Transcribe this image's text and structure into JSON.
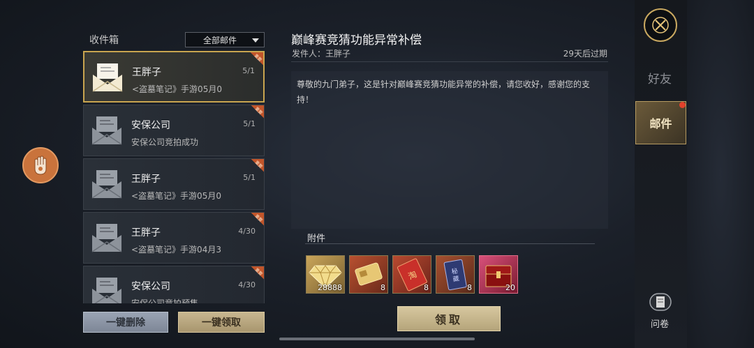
{
  "inbox": {
    "title": "收件箱",
    "filter_value": "全部邮件",
    "mails": [
      {
        "sender": "王胖子",
        "preview": "<盗墓笔记》手游05月0",
        "date": "5/1",
        "tag": "重要",
        "selected": true,
        "opened": true
      },
      {
        "sender": "安保公司",
        "preview": "安保公司竞拍成功",
        "date": "5/1",
        "tag": "重要",
        "selected": false,
        "opened": false
      },
      {
        "sender": "王胖子",
        "preview": "<盗墓笔记》手游05月0",
        "date": "5/1",
        "tag": "重要",
        "selected": false,
        "opened": true
      },
      {
        "sender": "王胖子",
        "preview": "<盗墓笔记》手游04月3",
        "date": "4/30",
        "tag": "重要",
        "selected": false,
        "opened": true
      },
      {
        "sender": "安保公司",
        "preview": "安保公司竞拍预售",
        "date": "4/30",
        "tag": "重要",
        "selected": false,
        "opened": false
      }
    ],
    "delete_all_label": "一键删除",
    "claim_all_label": "一键领取"
  },
  "detail": {
    "title": "巅峰赛竞猜功能异常补偿",
    "sender_prefix": "发件人：",
    "sender": "王胖子",
    "expire": "29天后过期",
    "body": "尊敬的九门弟子，这是针对巅峰赛竞猜功能异常的补偿，请您收好，感谢您的支持！",
    "attachments_label": "附件",
    "attachments": [
      {
        "icon": "diamond-icon",
        "count": "28888"
      },
      {
        "icon": "card-icon",
        "count": "8"
      },
      {
        "icon": "red-ticket-icon",
        "count": "8"
      },
      {
        "icon": "blue-ticket-icon",
        "count": "8"
      },
      {
        "icon": "red-chest-icon",
        "count": "20"
      }
    ],
    "claim_label": "领取"
  },
  "sidebar": {
    "friends_label": "好友",
    "mail_label": "邮件",
    "survey_label": "问卷"
  },
  "colors": {
    "accent_gold": "#c9a54f",
    "tag_red": "#c2552a",
    "notify_red": "#e2412b",
    "hand_orange": "#c9733c"
  }
}
